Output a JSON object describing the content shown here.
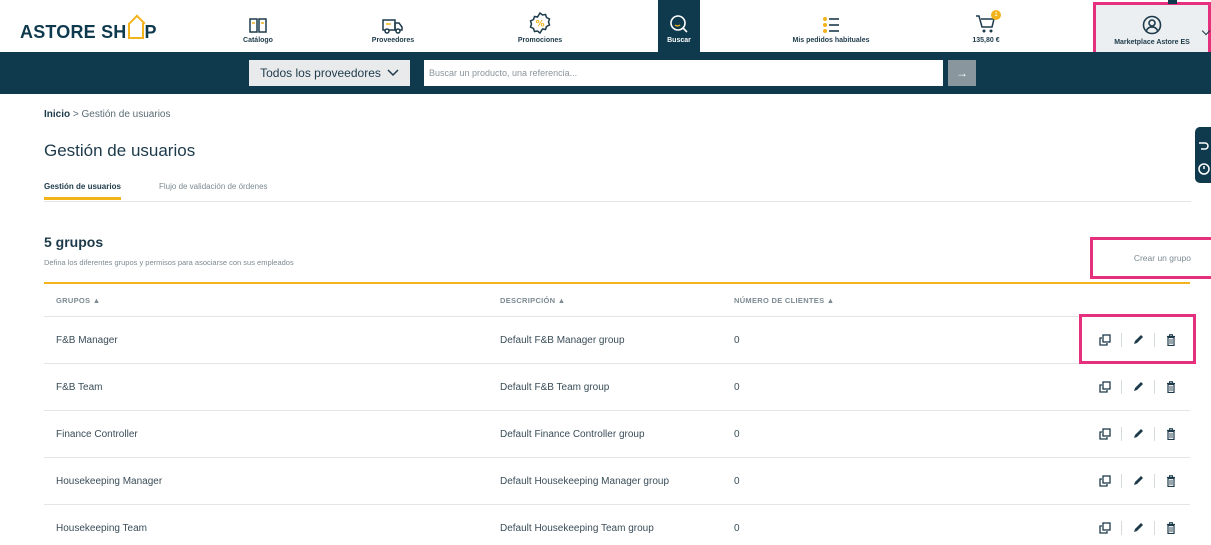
{
  "header": {
    "logo": "ASTORE SH",
    "logo_suffix": "P",
    "nav": [
      {
        "label": "Catálogo",
        "icon": "book-icon"
      },
      {
        "label": "Proveedores",
        "icon": "truck-icon"
      },
      {
        "label": "Promociones",
        "icon": "percent-badge-icon"
      },
      {
        "label": "Buscar",
        "icon": "search-icon"
      },
      {
        "label": "Mis pedidos habituales",
        "icon": "list-icon"
      },
      {
        "label": "135,80 €",
        "icon": "cart-icon",
        "badge": "1"
      }
    ],
    "account_label": "Marketplace Astore ES"
  },
  "search": {
    "supplier_label": "Todos los proveedores",
    "placeholder": "Buscar un producto, una referencia...",
    "go_symbol": "→"
  },
  "breadcrumb": {
    "home": "Inicio",
    "separator": ">",
    "current": "Gestión de usuarios"
  },
  "page_title": "Gestión de usuarios",
  "tabs": [
    {
      "label": "Gestión de usuarios",
      "active": true
    },
    {
      "label": "Flujo de validación de órdenes",
      "active": false
    }
  ],
  "groups_section": {
    "title": "5 grupos",
    "subtitle": "Defina los diferentes grupos y permisos para asociarse con sus empleados",
    "create_label": "Crear un grupo"
  },
  "table": {
    "columns": [
      "GRUPOS ▲",
      "DESCRIPCIÓN ▲",
      "NÚMERO DE CLIENTES ▲"
    ],
    "rows": [
      {
        "group": "F&B Manager",
        "description": "Default F&B Manager group",
        "clients": "0"
      },
      {
        "group": "F&B Team",
        "description": "Default F&B Team group",
        "clients": "0"
      },
      {
        "group": "Finance Controller",
        "description": "Default Finance Controller group",
        "clients": "0"
      },
      {
        "group": "Housekeeping Manager",
        "description": "Default Housekeeping Manager group",
        "clients": "0"
      },
      {
        "group": "Housekeeping Team",
        "description": "Default Housekeeping Team group",
        "clients": "0"
      }
    ]
  },
  "colors": {
    "navy": "#0f3a4e",
    "accent": "#f2b31b",
    "highlight": "#e4307d"
  }
}
